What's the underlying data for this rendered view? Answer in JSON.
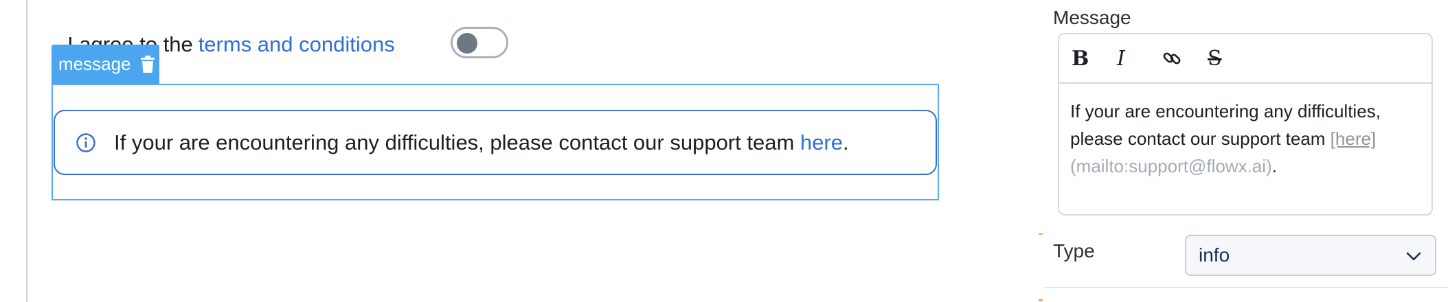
{
  "canvas": {
    "terms_prefix": "I agree to the",
    "terms_link": "terms and conditions",
    "toggle_on": false,
    "tag_label": "message",
    "message": {
      "text": "If your are encountering any difficulties, please contact our support team",
      "link": "here",
      "suffix": "."
    }
  },
  "panel": {
    "message_label": "Message",
    "toolbar": {
      "bold": "B",
      "italic": "I",
      "strike": "S"
    },
    "editor_text": "If your are encountering any difficulties, please contact our support team ",
    "editor_link": "[here]",
    "editor_url": "(mailto:support@flowx.ai)",
    "editor_suffix": ".",
    "type_label": "Type",
    "type_value": "info"
  },
  "icons": {
    "tag": "trash-icon",
    "message": "info-circle-icon",
    "link_tool": "link-icon",
    "select": "chevron-down-icon"
  },
  "colors": {
    "link": "#2f6fd6",
    "selection": "#4ba6ef",
    "message_border": "#3a6fd0"
  }
}
